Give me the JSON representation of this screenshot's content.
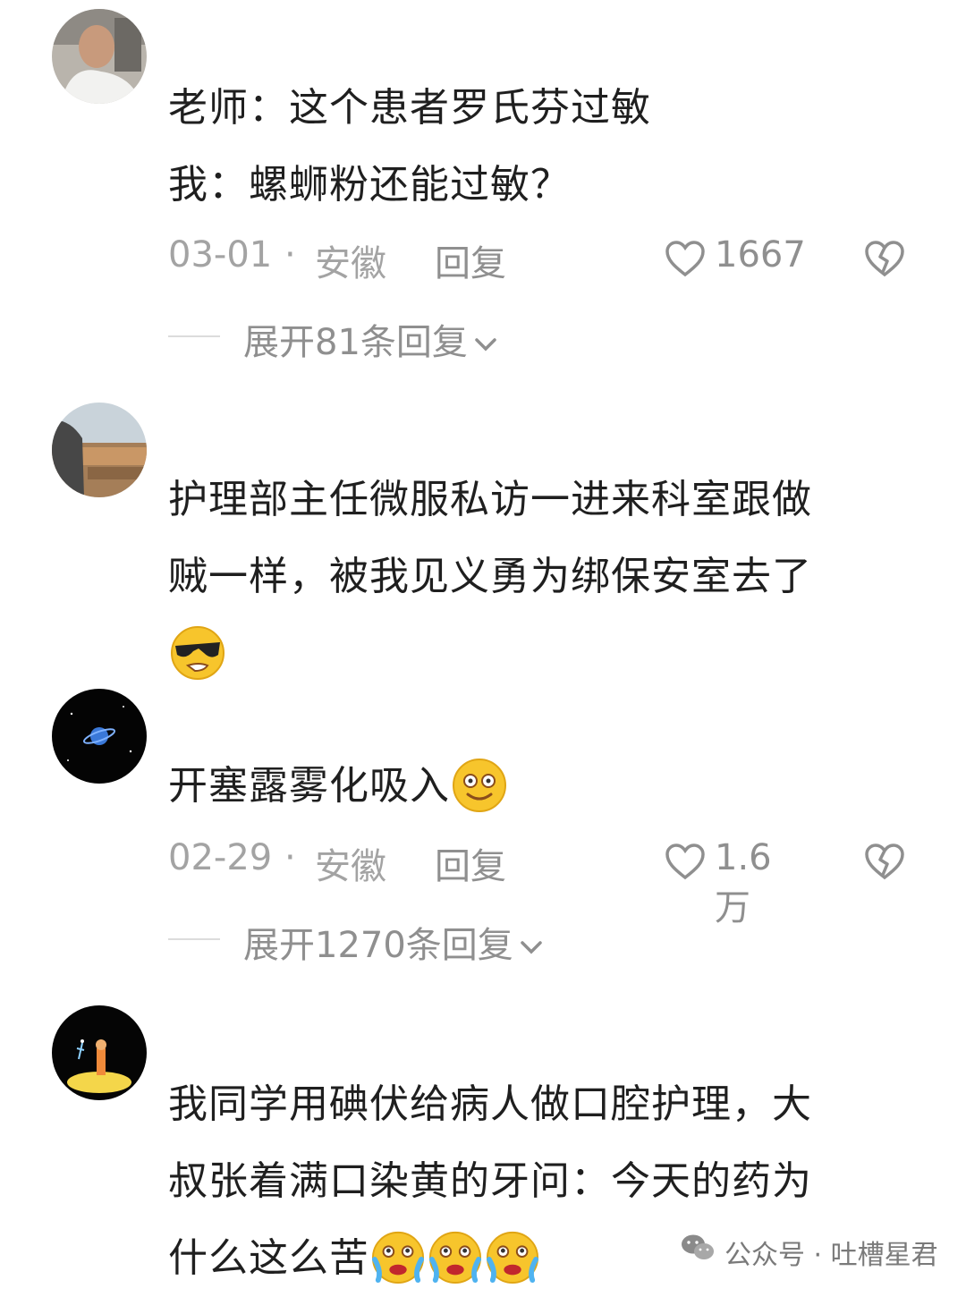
{
  "comments": [
    {
      "lines": [
        "老师：这个患者罗氏芬过敏",
        "我：螺蛳粉还能过敏？"
      ],
      "date": "03-01",
      "location": "安徽",
      "reply_label": "回复",
      "likes": "1667",
      "expand_label": "展开81条回复"
    },
    {
      "lines": [
        "护理部主任微服私访一进来科室跟做",
        "贼一样，被我见义勇为绑保安室去了"
      ],
      "emoji": "cool-sunglasses-emoji"
    },
    {
      "lines": [
        "开塞露雾化吸入"
      ],
      "emoji": "smile-emoji",
      "date": "02-29",
      "location": "安徽",
      "reply_label": "回复",
      "likes": "1.6万",
      "expand_label": "展开1270条回复"
    },
    {
      "lines": [
        "我同学用碘伏给病人做口腔护理，大",
        "叔张着满口染黄的牙问：今天的药为",
        "什么这么苦"
      ],
      "emoji": "crying-emoji"
    }
  ],
  "separator": "·",
  "watermark": "公众号 · 吐槽星君",
  "colors": {
    "text": "#1f1f1f",
    "meta": "#a3a3a3",
    "emoji_yellow": "#f7c52c"
  }
}
